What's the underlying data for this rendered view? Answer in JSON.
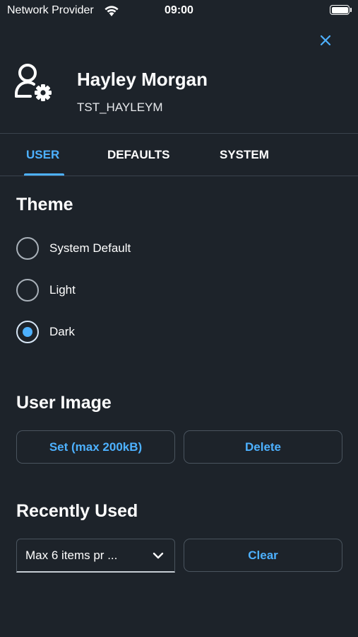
{
  "status_bar": {
    "carrier": "Network Provider",
    "time": "09:00",
    "battery_level": 1.0
  },
  "header": {
    "name": "Hayley Morgan",
    "user_id": "TST_HAYLEYM",
    "icon": "user-settings-icon",
    "close_icon": "close-icon"
  },
  "tabs": [
    {
      "label": "USER",
      "active": true
    },
    {
      "label": "DEFAULTS",
      "active": false
    },
    {
      "label": "SYSTEM",
      "active": false
    }
  ],
  "theme": {
    "title": "Theme",
    "options": [
      {
        "label": "System Default",
        "selected": false
      },
      {
        "label": "Light",
        "selected": false
      },
      {
        "label": "Dark",
        "selected": true
      }
    ]
  },
  "user_image": {
    "title": "User Image",
    "set_label": "Set (max 200kB)",
    "delete_label": "Delete"
  },
  "recently_used": {
    "title": "Recently Used",
    "select_value": "Max 6 items pr ...",
    "clear_label": "Clear"
  },
  "colors": {
    "background": "#1d232a",
    "accent": "#4db1ff",
    "text": "#ffffff",
    "border": "#4a545e"
  }
}
